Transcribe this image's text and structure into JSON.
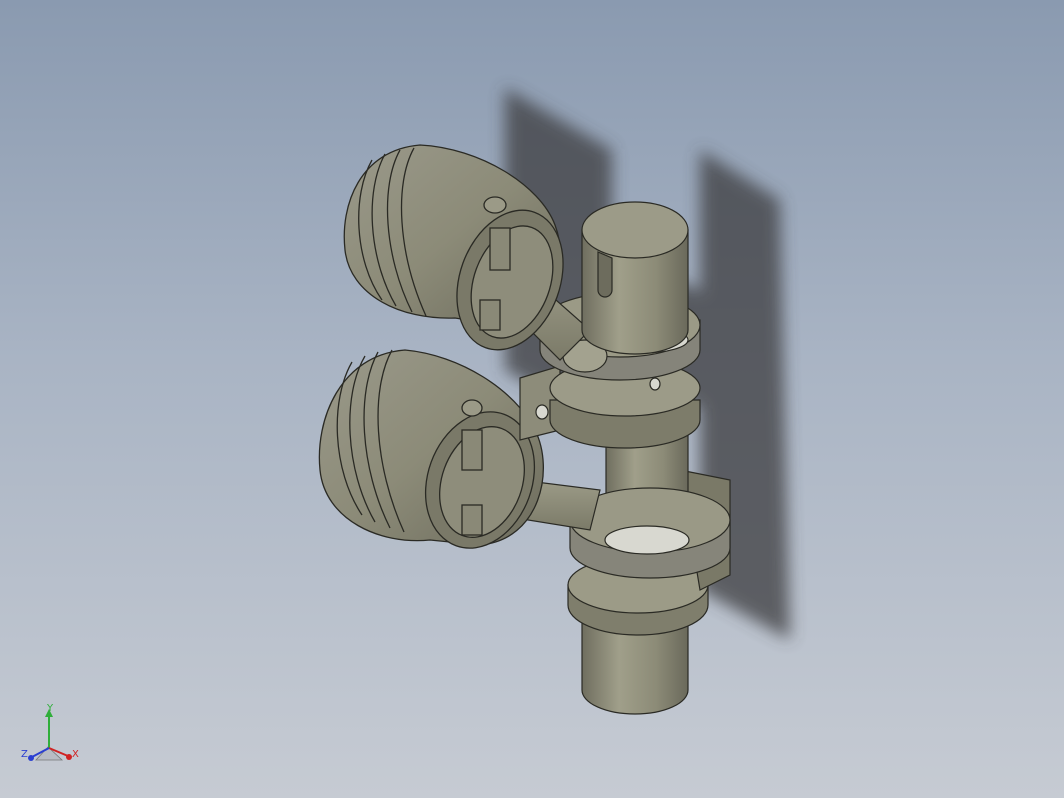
{
  "viewport": {
    "background_top": "#8a9ab0",
    "background_bottom": "#c6cbd3",
    "model_color": "#8d8c7a",
    "edge_color": "#2a2a24"
  },
  "triad": {
    "y_label": "Y",
    "x_label": "X",
    "z_label": "Z",
    "y_color": "#2fae3a",
    "x_color": "#d02323",
    "z_color": "#2b3fd1"
  }
}
